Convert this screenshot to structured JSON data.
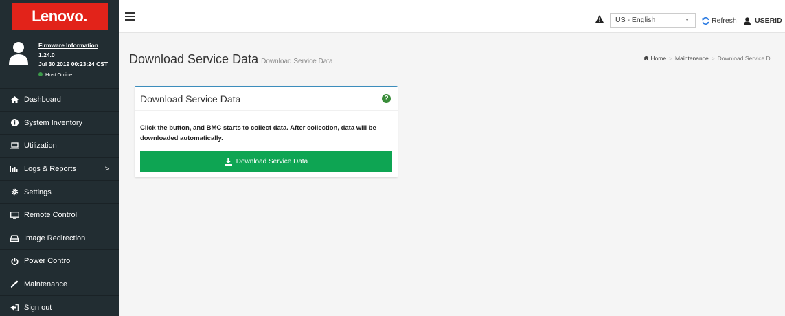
{
  "brand": {
    "logo_text": "Lenovo."
  },
  "user_panel": {
    "firmware_title": "Firmware Information",
    "version": "1.24.0",
    "datetime": "Jul 30 2019 00:23:24 CST",
    "host_status": "Host Online",
    "status_color": "#3c9b4a"
  },
  "sidebar": {
    "items": [
      {
        "label": "Dashboard",
        "icon": "home-icon"
      },
      {
        "label": "System Inventory",
        "icon": "info-icon"
      },
      {
        "label": "Utilization",
        "icon": "laptop-icon"
      },
      {
        "label": "Logs & Reports",
        "icon": "bar-chart-icon",
        "chevron": ">"
      },
      {
        "label": "Settings",
        "icon": "gear-icon"
      },
      {
        "label": "Remote Control",
        "icon": "monitor-icon"
      },
      {
        "label": "Image Redirection",
        "icon": "drive-icon"
      },
      {
        "label": "Power Control",
        "icon": "power-icon"
      },
      {
        "label": "Maintenance",
        "icon": "wrench-icon"
      },
      {
        "label": "Sign out",
        "icon": "sign-out-icon"
      }
    ]
  },
  "topbar": {
    "language": "US - English",
    "refresh_label": "Refresh",
    "user_label": "USERID"
  },
  "page": {
    "title": "Download Service Data",
    "subtitle": "Download Service Data"
  },
  "breadcrumb": {
    "home": "Home",
    "sep": ">",
    "maintenance": "Maintenance",
    "current": "Download Service D"
  },
  "card": {
    "title": "Download Service Data",
    "help_glyph": "?",
    "description": "Click the button, and BMC starts to collect data. After collection, data will be downloaded automatically.",
    "button_label": "Download Service Data"
  },
  "colors": {
    "sidebar_bg": "#222d32",
    "brand_red": "#e2231a",
    "button_green": "#0ea553",
    "card_accent": "#3c8dbc"
  }
}
